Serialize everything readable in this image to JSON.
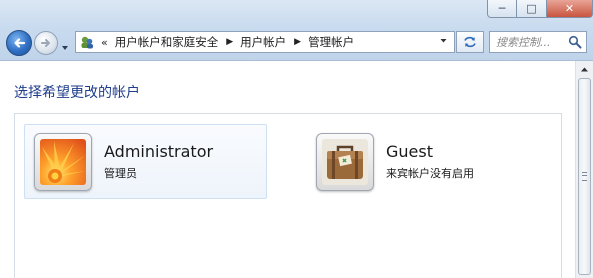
{
  "window": {
    "minimize_glyph": "─",
    "maximize_glyph": "□",
    "close_glyph": "✕"
  },
  "nav": {
    "back_icon": "back-arrow-icon",
    "forward_icon": "forward-arrow-icon"
  },
  "address_bar": {
    "overflow_chevron": "«",
    "breadcrumbs": [
      "用户帐户和家庭安全",
      "用户帐户",
      "管理帐户"
    ],
    "separator": "▶"
  },
  "search": {
    "placeholder": "搜索控制..."
  },
  "content": {
    "heading": "选择希望更改的帐户",
    "accounts": [
      {
        "name": "Administrator",
        "role": "管理员",
        "icon": "flower-avatar-icon",
        "selected": true
      },
      {
        "name": "Guest",
        "role": "来宾帐户没有启用",
        "icon": "suitcase-avatar-icon",
        "selected": false
      }
    ]
  },
  "colors": {
    "heading": "#1e3d8c",
    "chrome": "#c9dbef",
    "selection": "#eef4fb"
  }
}
